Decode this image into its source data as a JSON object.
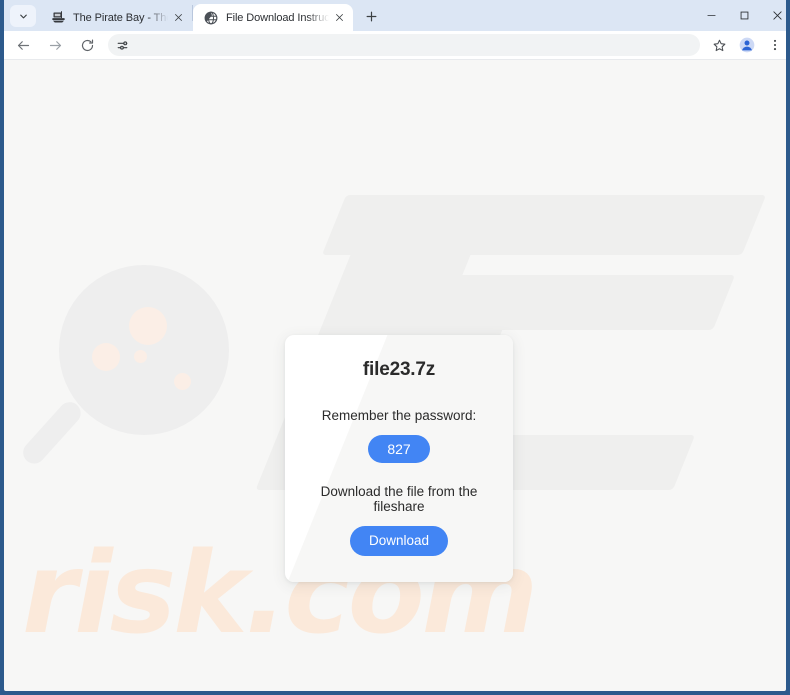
{
  "window": {
    "controls": {
      "minimize_label": "Minimize",
      "maximize_label": "Maximize",
      "close_label": "Close"
    },
    "frame_color": "#2d5a8c"
  },
  "tabstrip": {
    "tab_search_label": "Search tabs",
    "new_tab_label": "New tab",
    "tabs": [
      {
        "title": "The Pirate Bay - The galaxy's m",
        "favicon": "pirate-ship-icon",
        "active": false,
        "close_label": "Close tab"
      },
      {
        "title": "File Download Instructions for f",
        "favicon": "globe-icon",
        "active": true,
        "close_label": "Close tab"
      }
    ]
  },
  "toolbar": {
    "back_label": "Back",
    "forward_label": "Forward",
    "reload_label": "Reload",
    "omnibox": {
      "value": "",
      "placeholder": "",
      "tune_icon": "tune-icon"
    },
    "bookmark_label": "Bookmark this tab",
    "profile_label": "Profile",
    "menu_label": "Customize and control Google Chrome"
  },
  "page": {
    "background_color": "#f7f7f6",
    "watermark": {
      "text": "risk.com",
      "text_color": "#fbe9da",
      "shape_color": "#efefee",
      "dot_color": "#fbeee6",
      "glass_icon": "magnifying-glass-icon"
    },
    "card": {
      "title": "file23.7z",
      "password_label": "Remember the password:",
      "password_value": "827",
      "download_label": "Download the file from the fileshare",
      "download_button": "Download",
      "accent_color": "#4285f4"
    }
  }
}
